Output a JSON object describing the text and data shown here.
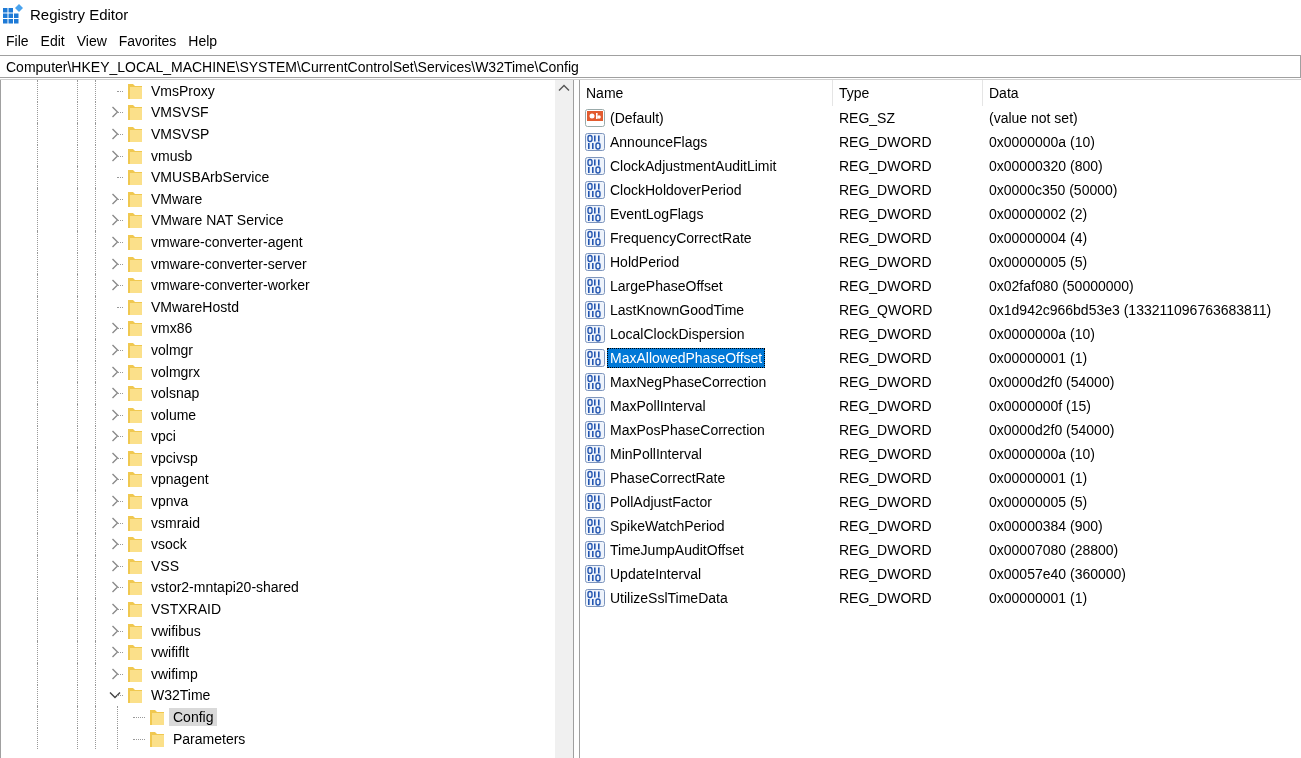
{
  "window": {
    "title": "Registry Editor"
  },
  "menu": [
    "File",
    "Edit",
    "View",
    "Favorites",
    "Help"
  ],
  "address": "Computer\\HKEY_LOCAL_MACHINE\\SYSTEM\\CurrentControlSet\\Services\\W32Time\\Config",
  "tree": [
    {
      "label": "VmsProxy",
      "expandable": false,
      "selected": false
    },
    {
      "label": "VMSVSF",
      "expandable": true,
      "expanded": false,
      "selected": false
    },
    {
      "label": "VMSVSP",
      "expandable": true,
      "expanded": false,
      "selected": false
    },
    {
      "label": "vmusb",
      "expandable": true,
      "expanded": false,
      "selected": false
    },
    {
      "label": "VMUSBArbService",
      "expandable": false,
      "selected": false
    },
    {
      "label": "VMware",
      "expandable": true,
      "expanded": false,
      "selected": false
    },
    {
      "label": "VMware NAT Service",
      "expandable": true,
      "expanded": false,
      "selected": false
    },
    {
      "label": "vmware-converter-agent",
      "expandable": true,
      "expanded": false,
      "selected": false
    },
    {
      "label": "vmware-converter-server",
      "expandable": true,
      "expanded": false,
      "selected": false
    },
    {
      "label": "vmware-converter-worker",
      "expandable": true,
      "expanded": false,
      "selected": false
    },
    {
      "label": "VMwareHostd",
      "expandable": false,
      "selected": false
    },
    {
      "label": "vmx86",
      "expandable": true,
      "expanded": false,
      "selected": false
    },
    {
      "label": "volmgr",
      "expandable": true,
      "expanded": false,
      "selected": false
    },
    {
      "label": "volmgrx",
      "expandable": true,
      "expanded": false,
      "selected": false
    },
    {
      "label": "volsnap",
      "expandable": true,
      "expanded": false,
      "selected": false
    },
    {
      "label": "volume",
      "expandable": true,
      "expanded": false,
      "selected": false
    },
    {
      "label": "vpci",
      "expandable": true,
      "expanded": false,
      "selected": false
    },
    {
      "label": "vpcivsp",
      "expandable": true,
      "expanded": false,
      "selected": false
    },
    {
      "label": "vpnagent",
      "expandable": true,
      "expanded": false,
      "selected": false
    },
    {
      "label": "vpnva",
      "expandable": true,
      "expanded": false,
      "selected": false
    },
    {
      "label": "vsmraid",
      "expandable": true,
      "expanded": false,
      "selected": false
    },
    {
      "label": "vsock",
      "expandable": true,
      "expanded": false,
      "selected": false
    },
    {
      "label": "VSS",
      "expandable": true,
      "expanded": false,
      "selected": false
    },
    {
      "label": "vstor2-mntapi20-shared",
      "expandable": true,
      "expanded": false,
      "selected": false
    },
    {
      "label": "VSTXRAID",
      "expandable": true,
      "expanded": false,
      "selected": false
    },
    {
      "label": "vwifibus",
      "expandable": true,
      "expanded": false,
      "selected": false
    },
    {
      "label": "vwififlt",
      "expandable": true,
      "expanded": false,
      "selected": false
    },
    {
      "label": "vwifimp",
      "expandable": true,
      "expanded": false,
      "selected": false
    },
    {
      "label": "W32Time",
      "expandable": true,
      "expanded": true,
      "selected": false,
      "children": [
        {
          "label": "Config",
          "expandable": false,
          "selected": true
        },
        {
          "label": "Parameters",
          "expandable": false,
          "selected": false
        }
      ]
    }
  ],
  "table": {
    "columns": [
      "Name",
      "Type",
      "Data"
    ],
    "rows": [
      {
        "kind": "string",
        "name": "(Default)",
        "type": "REG_SZ",
        "data": "(value not set)",
        "selected": false
      },
      {
        "kind": "binary",
        "name": "AnnounceFlags",
        "type": "REG_DWORD",
        "data": "0x0000000a (10)",
        "selected": false
      },
      {
        "kind": "binary",
        "name": "ClockAdjustmentAuditLimit",
        "type": "REG_DWORD",
        "data": "0x00000320 (800)",
        "selected": false
      },
      {
        "kind": "binary",
        "name": "ClockHoldoverPeriod",
        "type": "REG_DWORD",
        "data": "0x0000c350 (50000)",
        "selected": false
      },
      {
        "kind": "binary",
        "name": "EventLogFlags",
        "type": "REG_DWORD",
        "data": "0x00000002 (2)",
        "selected": false
      },
      {
        "kind": "binary",
        "name": "FrequencyCorrectRate",
        "type": "REG_DWORD",
        "data": "0x00000004 (4)",
        "selected": false
      },
      {
        "kind": "binary",
        "name": "HoldPeriod",
        "type": "REG_DWORD",
        "data": "0x00000005 (5)",
        "selected": false
      },
      {
        "kind": "binary",
        "name": "LargePhaseOffset",
        "type": "REG_DWORD",
        "data": "0x02faf080 (50000000)",
        "selected": false
      },
      {
        "kind": "binary",
        "name": "LastKnownGoodTime",
        "type": "REG_QWORD",
        "data": "0x1d942c966bd53e3 (133211096763683811)",
        "selected": false
      },
      {
        "kind": "binary",
        "name": "LocalClockDispersion",
        "type": "REG_DWORD",
        "data": "0x0000000a (10)",
        "selected": false
      },
      {
        "kind": "binary",
        "name": "MaxAllowedPhaseOffset",
        "type": "REG_DWORD",
        "data": "0x00000001 (1)",
        "selected": true
      },
      {
        "kind": "binary",
        "name": "MaxNegPhaseCorrection",
        "type": "REG_DWORD",
        "data": "0x0000d2f0 (54000)",
        "selected": false
      },
      {
        "kind": "binary",
        "name": "MaxPollInterval",
        "type": "REG_DWORD",
        "data": "0x0000000f (15)",
        "selected": false
      },
      {
        "kind": "binary",
        "name": "MaxPosPhaseCorrection",
        "type": "REG_DWORD",
        "data": "0x0000d2f0 (54000)",
        "selected": false
      },
      {
        "kind": "binary",
        "name": "MinPollInterval",
        "type": "REG_DWORD",
        "data": "0x0000000a (10)",
        "selected": false
      },
      {
        "kind": "binary",
        "name": "PhaseCorrectRate",
        "type": "REG_DWORD",
        "data": "0x00000001 (1)",
        "selected": false
      },
      {
        "kind": "binary",
        "name": "PollAdjustFactor",
        "type": "REG_DWORD",
        "data": "0x00000005 (5)",
        "selected": false
      },
      {
        "kind": "binary",
        "name": "SpikeWatchPeriod",
        "type": "REG_DWORD",
        "data": "0x00000384 (900)",
        "selected": false
      },
      {
        "kind": "binary",
        "name": "TimeJumpAuditOffset",
        "type": "REG_DWORD",
        "data": "0x00007080 (28800)",
        "selected": false
      },
      {
        "kind": "binary",
        "name": "UpdateInterval",
        "type": "REG_DWORD",
        "data": "0x00057e40 (360000)",
        "selected": false
      },
      {
        "kind": "binary",
        "name": "UtilizeSslTimeData",
        "type": "REG_DWORD",
        "data": "0x00000001 (1)",
        "selected": false
      }
    ]
  }
}
